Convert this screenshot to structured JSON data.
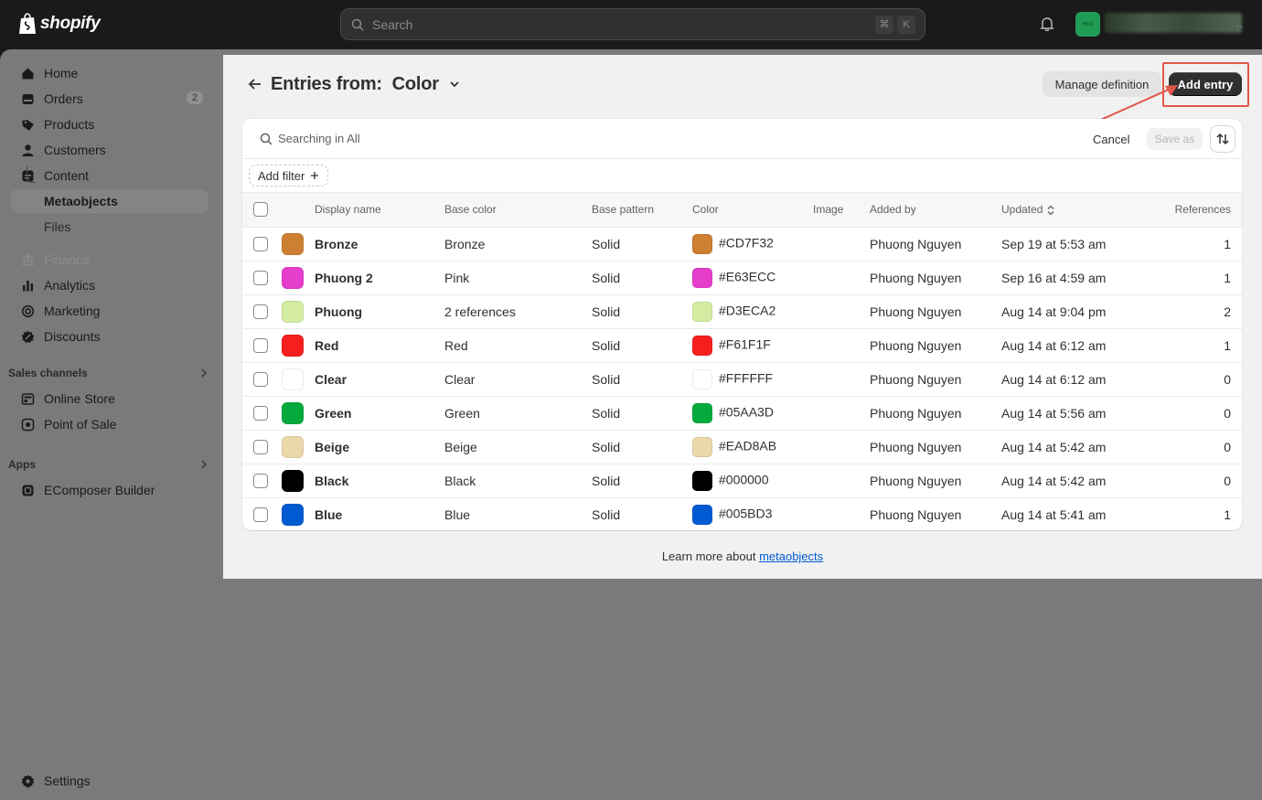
{
  "brand": {
    "logo_text": "shopify"
  },
  "topbar": {
    "search_placeholder": "Search",
    "shortcut_keys": [
      "⌘",
      "K"
    ],
    "avatar_initials": "eco"
  },
  "sidebar": {
    "items": [
      {
        "label": "Home",
        "icon": "home-icon"
      },
      {
        "label": "Orders",
        "icon": "orders-icon",
        "badge": "2"
      },
      {
        "label": "Products",
        "icon": "tag-icon"
      },
      {
        "label": "Customers",
        "icon": "person-icon"
      },
      {
        "label": "Content",
        "icon": "content-icon"
      },
      {
        "label": "Metaobjects",
        "active": true
      },
      {
        "label": "Files"
      },
      {
        "label": "Finance",
        "icon": "bank-icon",
        "disabled": true
      },
      {
        "label": "Analytics",
        "icon": "chart-icon"
      },
      {
        "label": "Marketing",
        "icon": "target-icon"
      },
      {
        "label": "Discounts",
        "icon": "discount-icon"
      }
    ],
    "sales_channels": {
      "heading": "Sales channels",
      "items": [
        {
          "label": "Online Store",
          "icon": "store-icon"
        },
        {
          "label": "Point of Sale",
          "icon": "pos-icon"
        }
      ]
    },
    "apps": {
      "heading": "Apps",
      "items": [
        {
          "label": "EComposer Builder",
          "icon": "app-icon"
        }
      ]
    },
    "settings_label": "Settings"
  },
  "page": {
    "title": "Entries from:  Color",
    "manage_label": "Manage definition",
    "add_label": "Add entry"
  },
  "filters": {
    "search_text": "Searching in All",
    "cancel_label": "Cancel",
    "saveas_label": "Save as",
    "add_filter_label": "Add filter"
  },
  "table": {
    "columns": [
      "Display name",
      "Base color",
      "Base pattern",
      "Color",
      "Image",
      "Added by",
      "Updated",
      "References"
    ],
    "rows": [
      {
        "name": "Bronze",
        "base_color": "Bronze",
        "pattern": "Solid",
        "hex": "#CD7F32",
        "added_by": "Phuong Nguyen",
        "updated": "Sep 19 at 5:53 am",
        "refs": "1"
      },
      {
        "name": "Phuong 2",
        "base_color": "Pink",
        "pattern": "Solid",
        "hex": "#E63ECC",
        "added_by": "Phuong Nguyen",
        "updated": "Sep 16 at 4:59 am",
        "refs": "1"
      },
      {
        "name": "Phuong",
        "base_color": "2 references",
        "pattern": "Solid",
        "hex": "#D3ECA2",
        "added_by": "Phuong Nguyen",
        "updated": "Aug 14 at 9:04 pm",
        "refs": "2"
      },
      {
        "name": "Red",
        "base_color": "Red",
        "pattern": "Solid",
        "hex": "#F61F1F",
        "added_by": "Phuong Nguyen",
        "updated": "Aug 14 at 6:12 am",
        "refs": "1"
      },
      {
        "name": "Clear",
        "base_color": "Clear",
        "pattern": "Solid",
        "hex": "#FFFFFF",
        "added_by": "Phuong Nguyen",
        "updated": "Aug 14 at 6:12 am",
        "refs": "0"
      },
      {
        "name": "Green",
        "base_color": "Green",
        "pattern": "Solid",
        "hex": "#05AA3D",
        "added_by": "Phuong Nguyen",
        "updated": "Aug 14 at 5:56 am",
        "refs": "0"
      },
      {
        "name": "Beige",
        "base_color": "Beige",
        "pattern": "Solid",
        "hex": "#EAD8AB",
        "added_by": "Phuong Nguyen",
        "updated": "Aug 14 at 5:42 am",
        "refs": "0"
      },
      {
        "name": "Black",
        "base_color": "Black",
        "pattern": "Solid",
        "hex": "#000000",
        "added_by": "Phuong Nguyen",
        "updated": "Aug 14 at 5:42 am",
        "refs": "0"
      },
      {
        "name": "Blue",
        "base_color": "Blue",
        "pattern": "Solid",
        "hex": "#005BD3",
        "added_by": "Phuong Nguyen",
        "updated": "Aug 14 at 5:41 am",
        "refs": "1"
      }
    ]
  },
  "footer": {
    "learn_prefix": "Learn more about ",
    "learn_link": "metaobjects"
  }
}
